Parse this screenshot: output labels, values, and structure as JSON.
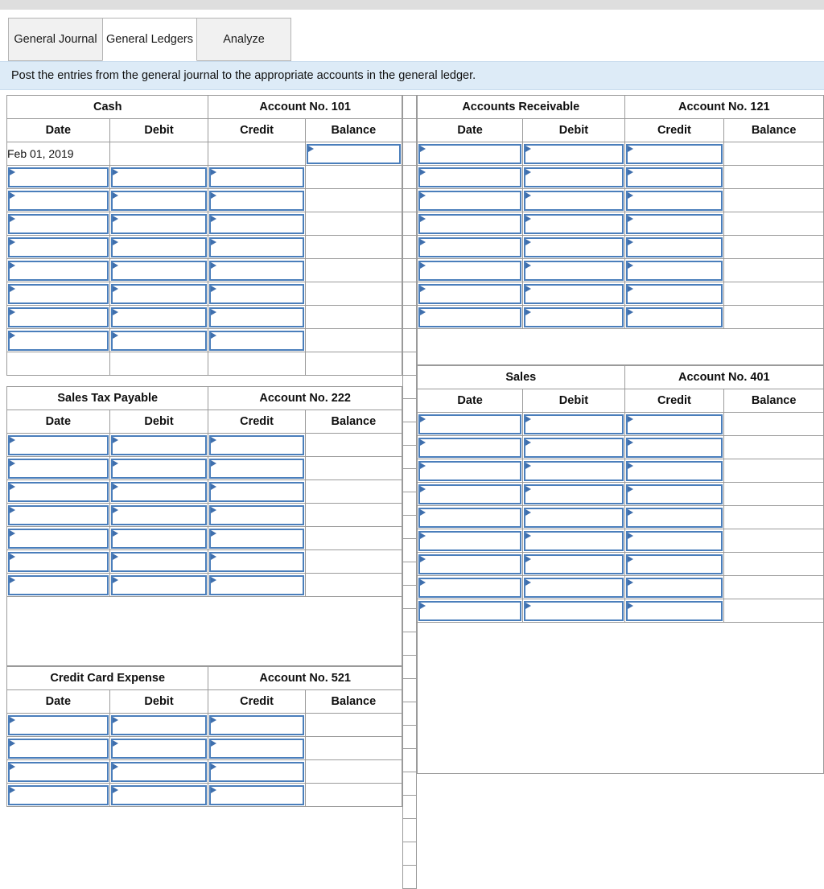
{
  "window": {
    "top_strip": ""
  },
  "tabs": [
    {
      "label": "General Journal",
      "active": false
    },
    {
      "label": "General Ledgers",
      "active": true
    },
    {
      "label": "Analyze",
      "active": false
    }
  ],
  "instruction": {
    "text": "Post the entries from the general journal to the appropriate accounts in the general ledger."
  },
  "columns": {
    "date": "Date",
    "debit": "Debit",
    "credit": "Credit",
    "balance": "Balance"
  },
  "colors": {
    "header_blue": "#82abdf",
    "instruction_blue": "#ddebf7",
    "input_border": "#4a7ebb",
    "grid_line": "#9a9a9a",
    "tab_inactive": "#f1f1f1",
    "top_strip": "#dedede"
  },
  "ledgers": {
    "cash": {
      "account_name": "Cash",
      "account_no": "Account No. 101",
      "rows": [
        {
          "date": "Feb 01, 2019",
          "date_input": false,
          "debit_input": false,
          "credit_input": false,
          "balance_input": true
        },
        {
          "date": "",
          "date_input": true,
          "debit_input": true,
          "credit_input": true,
          "balance_input": false
        },
        {
          "date": "",
          "date_input": true,
          "debit_input": true,
          "credit_input": true,
          "balance_input": false
        },
        {
          "date": "",
          "date_input": true,
          "debit_input": true,
          "credit_input": true,
          "balance_input": false
        },
        {
          "date": "",
          "date_input": true,
          "debit_input": true,
          "credit_input": true,
          "balance_input": false
        },
        {
          "date": "",
          "date_input": true,
          "debit_input": true,
          "credit_input": true,
          "balance_input": false
        },
        {
          "date": "",
          "date_input": true,
          "debit_input": true,
          "credit_input": true,
          "balance_input": false
        },
        {
          "date": "",
          "date_input": true,
          "debit_input": true,
          "credit_input": true,
          "balance_input": false
        },
        {
          "date": "",
          "date_input": true,
          "debit_input": true,
          "credit_input": true,
          "balance_input": false
        },
        {
          "date": "",
          "date_input": false,
          "debit_input": false,
          "credit_input": false,
          "balance_input": false
        }
      ]
    },
    "accounts_receivable": {
      "account_name": "Accounts Receivable",
      "account_no": "Account No. 121",
      "rows": [
        {
          "date": "",
          "date_input": true,
          "debit_input": true,
          "credit_input": true,
          "balance_input": false
        },
        {
          "date": "",
          "date_input": true,
          "debit_input": true,
          "credit_input": true,
          "balance_input": false
        },
        {
          "date": "",
          "date_input": true,
          "debit_input": true,
          "credit_input": true,
          "balance_input": false
        },
        {
          "date": "",
          "date_input": true,
          "debit_input": true,
          "credit_input": true,
          "balance_input": false
        },
        {
          "date": "",
          "date_input": true,
          "debit_input": true,
          "credit_input": true,
          "balance_input": false
        },
        {
          "date": "",
          "date_input": true,
          "debit_input": true,
          "credit_input": true,
          "balance_input": false
        },
        {
          "date": "",
          "date_input": true,
          "debit_input": true,
          "credit_input": true,
          "balance_input": false
        },
        {
          "date": "",
          "date_input": true,
          "debit_input": true,
          "credit_input": true,
          "balance_input": false
        }
      ]
    },
    "sales_tax_payable": {
      "account_name": "Sales Tax Payable",
      "account_no": "Account No. 222",
      "rows": [
        {
          "date": "",
          "date_input": true,
          "debit_input": true,
          "credit_input": true,
          "balance_input": false
        },
        {
          "date": "",
          "date_input": true,
          "debit_input": true,
          "credit_input": true,
          "balance_input": false
        },
        {
          "date": "",
          "date_input": true,
          "debit_input": true,
          "credit_input": true,
          "balance_input": false
        },
        {
          "date": "",
          "date_input": true,
          "debit_input": true,
          "credit_input": true,
          "balance_input": false
        },
        {
          "date": "",
          "date_input": true,
          "debit_input": true,
          "credit_input": true,
          "balance_input": false
        },
        {
          "date": "",
          "date_input": true,
          "debit_input": true,
          "credit_input": true,
          "balance_input": false
        },
        {
          "date": "",
          "date_input": true,
          "debit_input": true,
          "credit_input": true,
          "balance_input": false
        }
      ]
    },
    "sales": {
      "account_name": "Sales",
      "account_no": "Account No. 401",
      "rows": [
        {
          "date": "",
          "date_input": true,
          "debit_input": true,
          "credit_input": true,
          "balance_input": false
        },
        {
          "date": "",
          "date_input": true,
          "debit_input": true,
          "credit_input": true,
          "balance_input": false
        },
        {
          "date": "",
          "date_input": true,
          "debit_input": true,
          "credit_input": true,
          "balance_input": false
        },
        {
          "date": "",
          "date_input": true,
          "debit_input": true,
          "credit_input": true,
          "balance_input": false
        },
        {
          "date": "",
          "date_input": true,
          "debit_input": true,
          "credit_input": true,
          "balance_input": false
        },
        {
          "date": "",
          "date_input": true,
          "debit_input": true,
          "credit_input": true,
          "balance_input": false
        },
        {
          "date": "",
          "date_input": true,
          "debit_input": true,
          "credit_input": true,
          "balance_input": false
        },
        {
          "date": "",
          "date_input": true,
          "debit_input": true,
          "credit_input": true,
          "balance_input": false
        },
        {
          "date": "",
          "date_input": true,
          "debit_input": true,
          "credit_input": true,
          "balance_input": false
        }
      ]
    },
    "credit_card_expense": {
      "account_name": "Credit Card Expense",
      "account_no": "Account No. 521",
      "rows": [
        {
          "date": "",
          "date_input": true,
          "debit_input": true,
          "credit_input": true,
          "balance_input": false
        },
        {
          "date": "",
          "date_input": true,
          "debit_input": true,
          "credit_input": true,
          "balance_input": false
        },
        {
          "date": "",
          "date_input": true,
          "debit_input": true,
          "credit_input": true,
          "balance_input": false
        },
        {
          "date": "",
          "date_input": true,
          "debit_input": true,
          "credit_input": true,
          "balance_input": false
        }
      ]
    }
  }
}
